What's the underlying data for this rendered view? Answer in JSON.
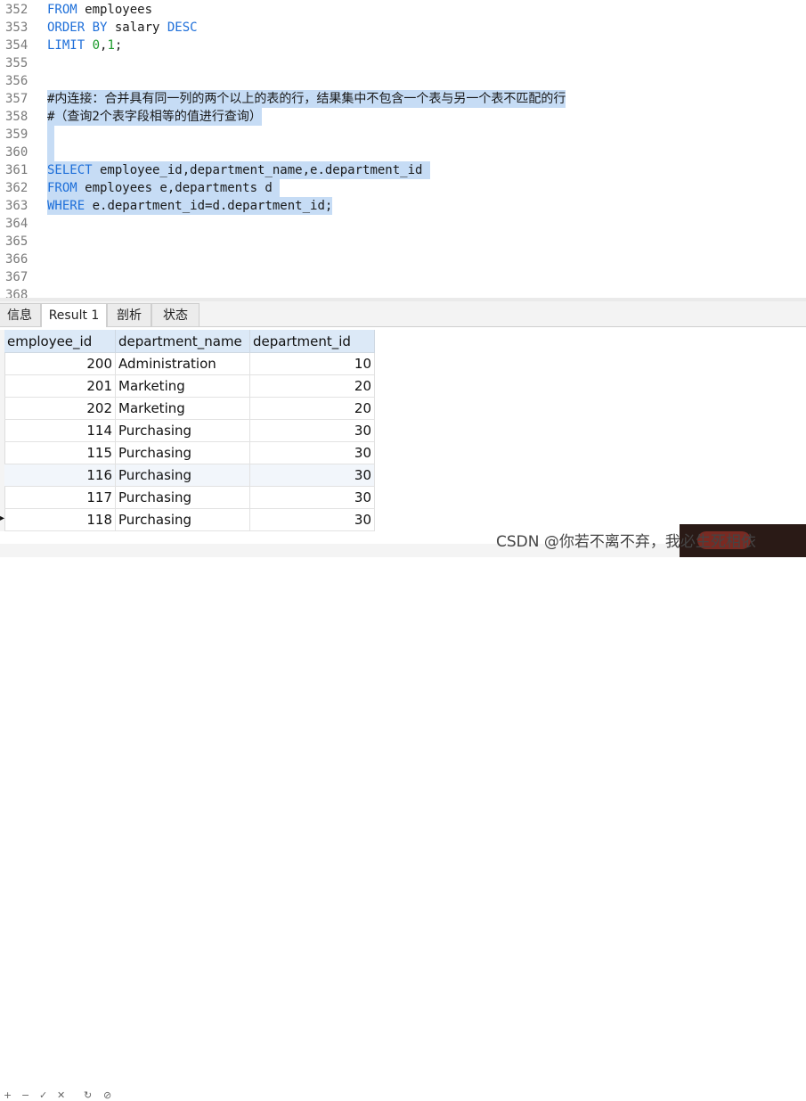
{
  "editor": {
    "lines": [
      {
        "no": "352",
        "parts": [
          {
            "t": "kw",
            "s": "FROM"
          },
          {
            "t": "plain",
            "s": " employees"
          }
        ]
      },
      {
        "no": "353",
        "parts": [
          {
            "t": "kw",
            "s": "ORDER BY"
          },
          {
            "t": "plain",
            "s": " salary "
          },
          {
            "t": "kw",
            "s": "DESC"
          }
        ]
      },
      {
        "no": "354",
        "parts": [
          {
            "t": "kw",
            "s": "LIMIT"
          },
          {
            "t": "plain",
            "s": " "
          },
          {
            "t": "num",
            "s": "0"
          },
          {
            "t": "plain",
            "s": ","
          },
          {
            "t": "num",
            "s": "1"
          },
          {
            "t": "plain",
            "s": ";"
          }
        ]
      },
      {
        "no": "355",
        "parts": []
      },
      {
        "no": "356",
        "parts": []
      },
      {
        "no": "357",
        "sel": true,
        "parts": [
          {
            "t": "comment",
            "s": "#内连接：合并具有同一列的两个以上的表的行，结果集中不包含一个表与另一个表不匹配的行"
          }
        ]
      },
      {
        "no": "358",
        "sel": true,
        "parts": [
          {
            "t": "comment",
            "s": "#（查询2个表字段相等的值进行查询）"
          }
        ]
      },
      {
        "no": "359",
        "sel": true,
        "parts": [
          {
            "t": "plain",
            "s": " "
          }
        ]
      },
      {
        "no": "360",
        "sel": true,
        "parts": [
          {
            "t": "plain",
            "s": " "
          }
        ]
      },
      {
        "no": "361",
        "sel": true,
        "parts": [
          {
            "t": "kw",
            "s": "SELECT"
          },
          {
            "t": "plain",
            "s": " employee_id,department_name,e.department_id "
          }
        ]
      },
      {
        "no": "362",
        "sel": true,
        "parts": [
          {
            "t": "kw",
            "s": "FROM"
          },
          {
            "t": "plain",
            "s": " employees e,departments d "
          }
        ]
      },
      {
        "no": "363",
        "sel": true,
        "parts": [
          {
            "t": "kw",
            "s": "WHERE"
          },
          {
            "t": "plain",
            "s": " e.department_id=d.department_id;"
          }
        ]
      },
      {
        "no": "364",
        "parts": []
      },
      {
        "no": "365",
        "parts": []
      },
      {
        "no": "366",
        "parts": []
      },
      {
        "no": "367",
        "parts": []
      },
      {
        "no": "368",
        "parts": []
      }
    ]
  },
  "tabs": [
    {
      "label": "信息",
      "active": false
    },
    {
      "label": "Result 1",
      "active": true
    },
    {
      "label": "剖析",
      "active": false
    },
    {
      "label": "状态",
      "active": false
    }
  ],
  "result": {
    "columns": [
      "employee_id",
      "department_name",
      "department_id"
    ],
    "rows": [
      [
        "200",
        "Administration",
        "10"
      ],
      [
        "201",
        "Marketing",
        "20"
      ],
      [
        "202",
        "Marketing",
        "20"
      ],
      [
        "114",
        "Purchasing",
        "30"
      ],
      [
        "115",
        "Purchasing",
        "30"
      ],
      [
        "116",
        "Purchasing",
        "30"
      ],
      [
        "117",
        "Purchasing",
        "30"
      ],
      [
        "118",
        "Purchasing",
        "30"
      ]
    ]
  },
  "watermark": "CSDN @你若不离不弃，我必生死相依",
  "colors": {
    "keyword": "#1e6fd9",
    "selection": "#c6dcf5",
    "header": "#dce9f7"
  }
}
